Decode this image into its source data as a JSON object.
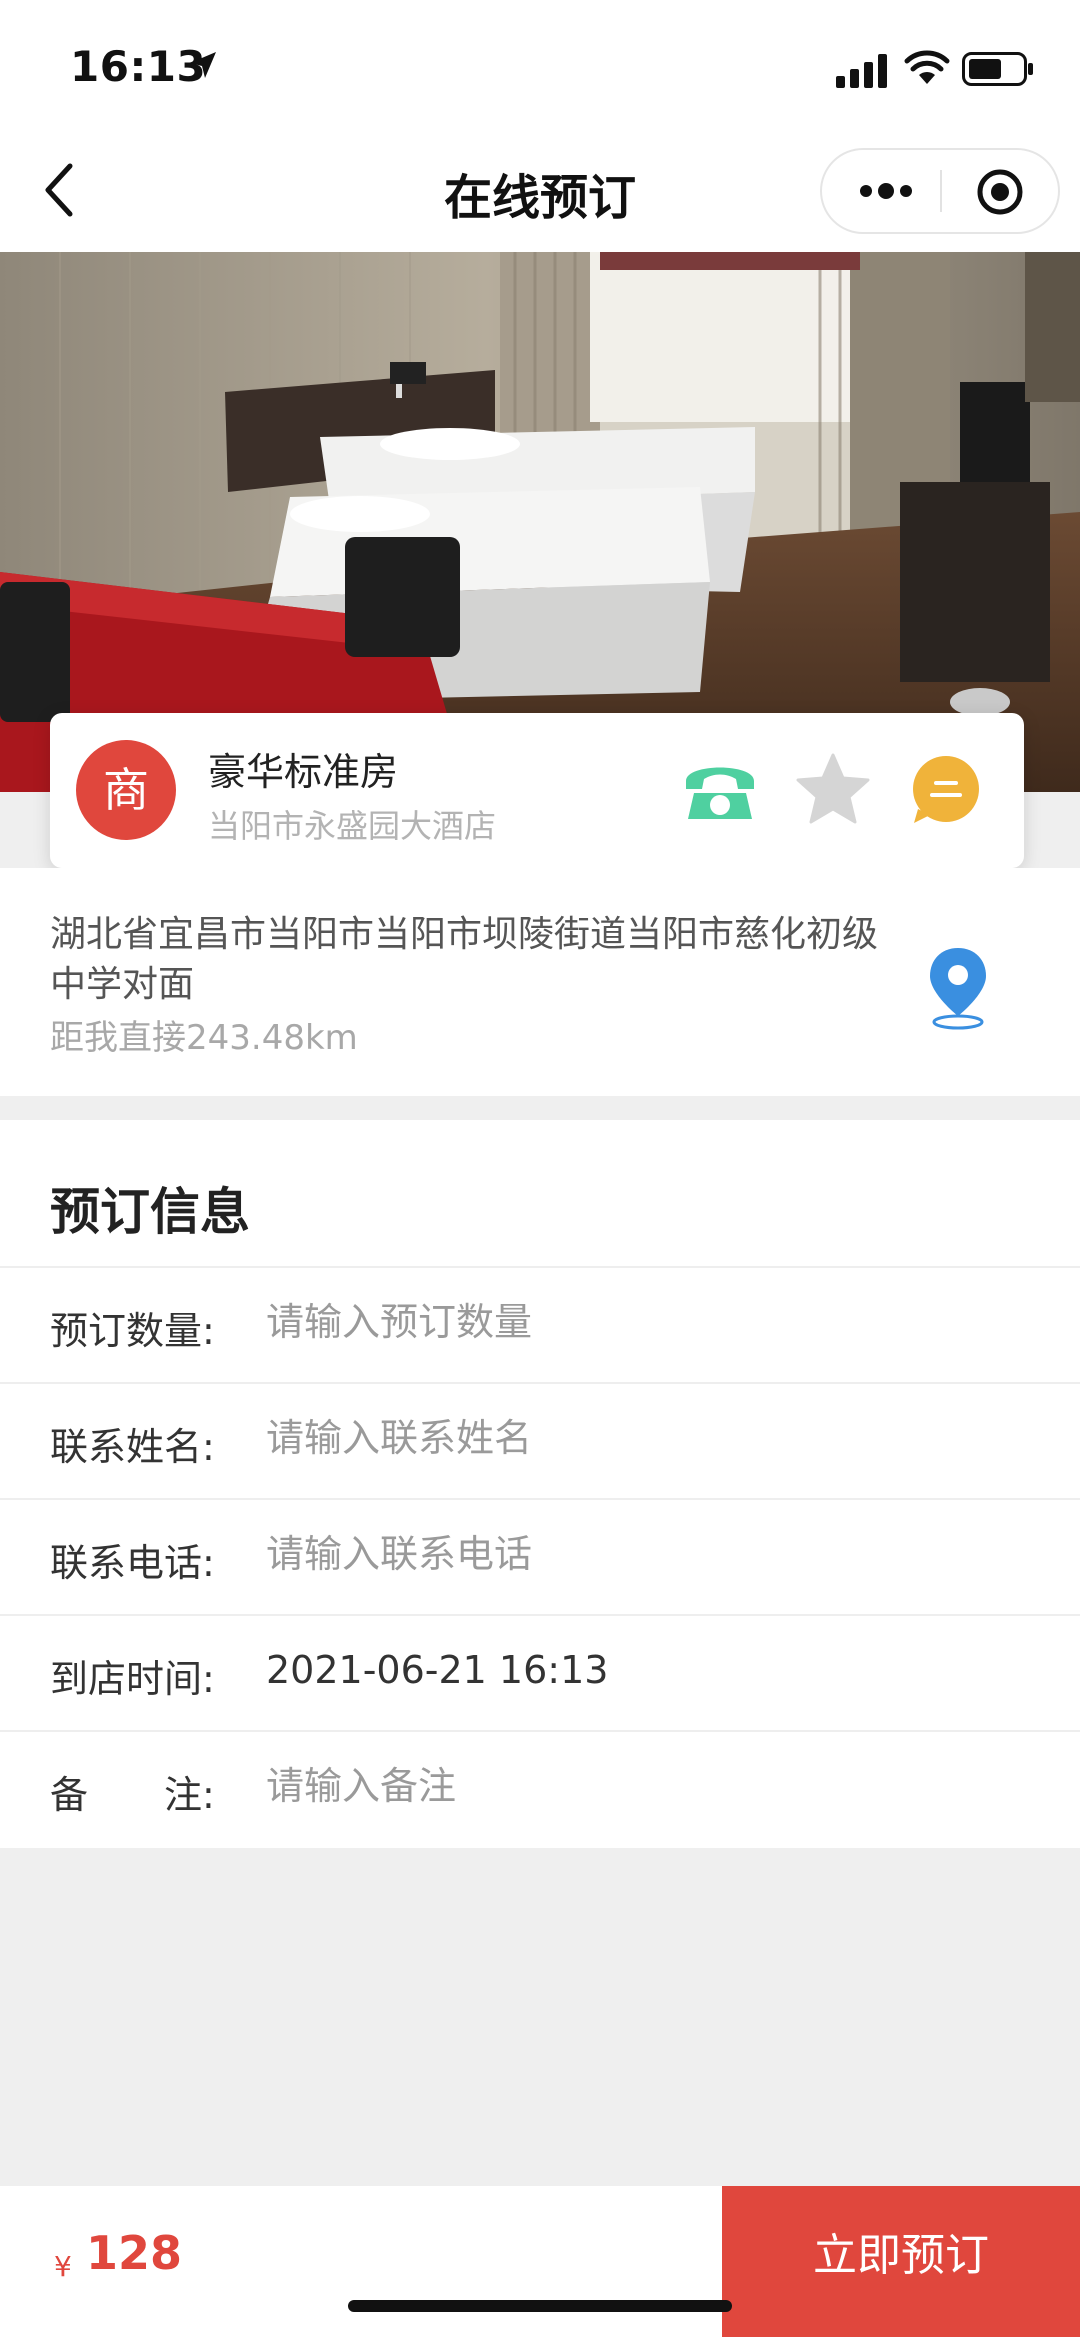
{
  "status_bar": {
    "time": "16:13"
  },
  "nav": {
    "title": "在线预订"
  },
  "shop": {
    "avatar_char": "商",
    "room_name": "豪华标准房",
    "hotel_name": "当阳市永盛园大酒店"
  },
  "location": {
    "address": "湖北省宜昌市当阳市当阳市坝陵街道当阳市慈化初级中学对面",
    "distance": "距我直接243.48km"
  },
  "booking": {
    "title": "预订信息",
    "rows": [
      {
        "label": "预订数量:",
        "placeholder": "请输入预订数量"
      },
      {
        "label": "联系姓名:",
        "placeholder": "请输入联系姓名"
      },
      {
        "label": "联系电话:",
        "placeholder": "请输入联系电话"
      },
      {
        "label": "到店时间:",
        "value": "2021-06-21 16:13"
      },
      {
        "label": "备　　注:",
        "placeholder": "请输入备注"
      }
    ]
  },
  "footer": {
    "currency": "¥",
    "price": "128",
    "book_button": "立即预订"
  },
  "colors": {
    "accent_red": "#e0473d",
    "phone_green": "#4fd0a0",
    "chat_orange": "#f0b33a",
    "pin_blue": "#3a8fe0"
  }
}
